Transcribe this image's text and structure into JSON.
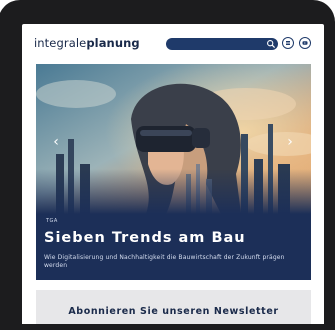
{
  "header": {
    "logo_part1": "integrale",
    "logo_part2": "planung",
    "search_icon": "search-icon",
    "menu_icon": "menu-icon",
    "play_icon": "play-icon"
  },
  "hero": {
    "tag": "TGA",
    "title": "Sieben Trends am Bau",
    "subtitle": "Wie Digitalisierung und Nachhaltigkeit die Bauwirtschaft der Zukunft prägen werden",
    "prev_icon": "chevron-left-icon",
    "next_icon": "chevron-right-icon"
  },
  "newsletter": {
    "title": "Abonnieren Sie unseren Newsletter"
  },
  "colors": {
    "brand": "#1f3a6a",
    "hero_panel": "#1c2f58",
    "device": "#1c1c1e"
  }
}
